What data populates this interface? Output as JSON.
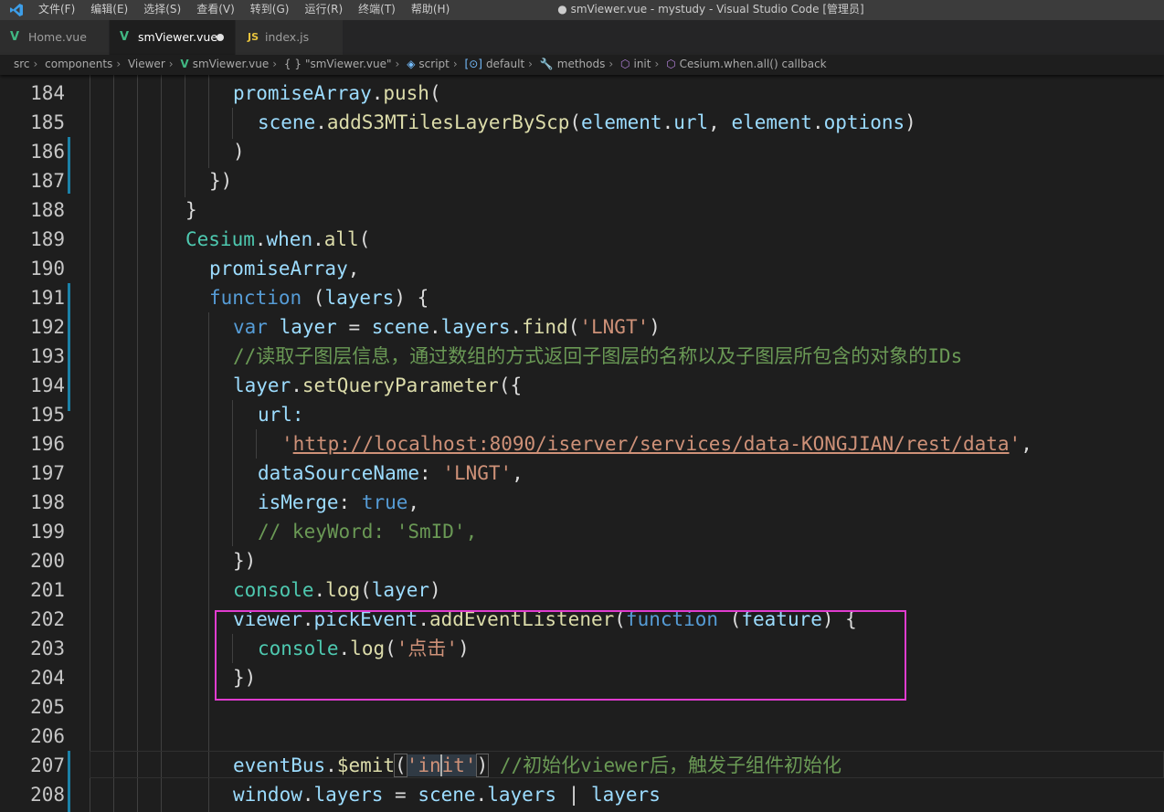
{
  "titlebar": {
    "menus": [
      "文件(F)",
      "编辑(E)",
      "选择(S)",
      "查看(V)",
      "转到(G)",
      "运行(R)",
      "终端(T)",
      "帮助(H)"
    ],
    "window_title": "● smViewer.vue - mystudy - Visual Studio Code [管理员]"
  },
  "tabs": [
    {
      "label": "Home.vue",
      "icon": "vue-icon",
      "active": false
    },
    {
      "label": "smViewer.vue",
      "icon": "vue-icon",
      "active": true,
      "modified": true
    },
    {
      "label": "index.js",
      "icon": "js-icon",
      "active": false
    }
  ],
  "breadcrumb": {
    "items": [
      "src",
      "components",
      "Viewer",
      "smViewer.vue",
      "\"smViewer.vue\"",
      "script",
      "default",
      "methods",
      "init",
      "Cesium.when.all() callback"
    ]
  },
  "editor": {
    "lines": [
      {
        "num": "184",
        "text": "promiseArray.push("
      },
      {
        "num": "185",
        "text": "scene.addS3MTilesLayerByScp(element.url, element.options)"
      },
      {
        "num": "186",
        "text": ")"
      },
      {
        "num": "187",
        "text": "})"
      },
      {
        "num": "188",
        "text": "}"
      },
      {
        "num": "189",
        "text": "Cesium.when.all("
      },
      {
        "num": "190",
        "text": "promiseArray,"
      },
      {
        "num": "191",
        "text": "function (layers) {"
      },
      {
        "num": "192",
        "text": "var layer = scene.layers.find('LNGT')"
      },
      {
        "num": "193",
        "text": "//读取子图层信息，通过数组的方式返回子图层的名称以及子图层所包含的对象的IDs"
      },
      {
        "num": "194",
        "text": "layer.setQueryParameter({"
      },
      {
        "num": "195",
        "text": "url:"
      },
      {
        "num": "196",
        "text": "'http://localhost:8090/iserver/services/data-KONGJIAN/rest/data',"
      },
      {
        "num": "197",
        "text": "dataSourceName: 'LNGT',"
      },
      {
        "num": "198",
        "text": "isMerge: true,"
      },
      {
        "num": "199",
        "text": "// keyWord: 'SmID',"
      },
      {
        "num": "200",
        "text": "})"
      },
      {
        "num": "201",
        "text": "console.log(layer)"
      },
      {
        "num": "202",
        "text": "viewer.pickEvent.addEventListener(function (feature) {"
      },
      {
        "num": "203",
        "text": "console.log('点击')"
      },
      {
        "num": "204",
        "text": "})"
      },
      {
        "num": "205",
        "text": ""
      },
      {
        "num": "206",
        "text": ""
      },
      {
        "num": "207",
        "text": "eventBus.$emit('init') //初始化viewer后，触发子组件初始化"
      },
      {
        "num": "208",
        "text": "window.layers = scene.layers | layers"
      }
    ]
  },
  "colors": {
    "highlight_box": "#e03ccf",
    "keyword": "#569cd6",
    "string": "#ce9178",
    "comment": "#6a9955",
    "variable": "#9cdcfe",
    "function": "#dcdcaa"
  }
}
